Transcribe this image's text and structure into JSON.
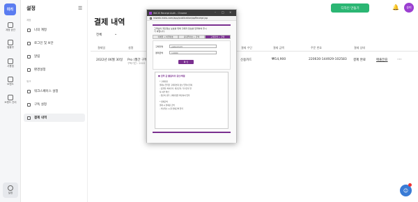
{
  "rail": {
    "logo": "미리",
    "items": [
      {
        "label": "계정 공간",
        "icon": "home-icon"
      },
      {
        "label": "템플릿",
        "icon": "template-icon"
      },
      {
        "label": "사용법",
        "icon": "guide-icon"
      },
      {
        "label": "브랜드",
        "icon": "brand-icon"
      },
      {
        "label": "브랜드 관리",
        "icon": "brand-manage-icon"
      }
    ],
    "settings_label": "설정"
  },
  "sidebar": {
    "title": "설정",
    "section_account": "계정",
    "section_workspace": "워크",
    "items": [
      {
        "label": "나의 계정"
      },
      {
        "label": "로그인 및 보안"
      },
      {
        "label": "알림"
      },
      {
        "label": "환경설정"
      },
      {
        "label": "워크스페이스 설정"
      },
      {
        "label": "구독 설정"
      },
      {
        "label": "결제 내역"
      }
    ]
  },
  "header": {
    "cta_label": "디자인 만들기",
    "avatar_text": "송미"
  },
  "main": {
    "title": "결제 내역",
    "filter": "전체",
    "columns": [
      "결제일",
      "설명",
      "결제 수단",
      "결제 금액",
      "주문 번호",
      "결제 상태"
    ],
    "row": {
      "date": "2022년 06월 30일",
      "desc": "Pro (월간 구독",
      "desc_sub": "구독기간 : 2022",
      "method": "신용카드",
      "amount": "₩14,900",
      "order": "220630-144929-102583",
      "status": "결제 완료",
      "receipt": "매출전표"
    }
  },
  "popup": {
    "window_title": "INICIS Receipt Auth - Chrome",
    "url": "iniweb.inicis.com/app/publication/apReceipt.jsp",
    "intro_line1": "고객님의 개인정보 보호를 위해 구매자 정보를 입력하여 주시",
    "intro_line2": "기 바랍니다.",
    "tabs": [
      "이메일 + 비밀번호",
      "휴대폰번호 + 금액",
      "구매자명 + 금액"
    ],
    "buyer_label": "구매자명",
    "buyer_value": "yebool123",
    "amount_label": "결제금액",
    "amount_value": "14900",
    "submit_label": "확 인",
    "note_title": "■ 입력 값 불일치의 원인/해결",
    "note_lines": [
      "* 구매자명",
      "결제시 입력한 구매자명과 정보 입력이 일치",
      "- 동일명, 띄어쓰기, 대소문자, 특수문자 일",
      "치 여부 확인",
      "- 법인의 경우 구매자명을 확인하여 입력",
      "* 결제금액",
      "결제 시 결제된 금액",
      "- 부분취소 시 원 결제금액 입력"
    ]
  }
}
